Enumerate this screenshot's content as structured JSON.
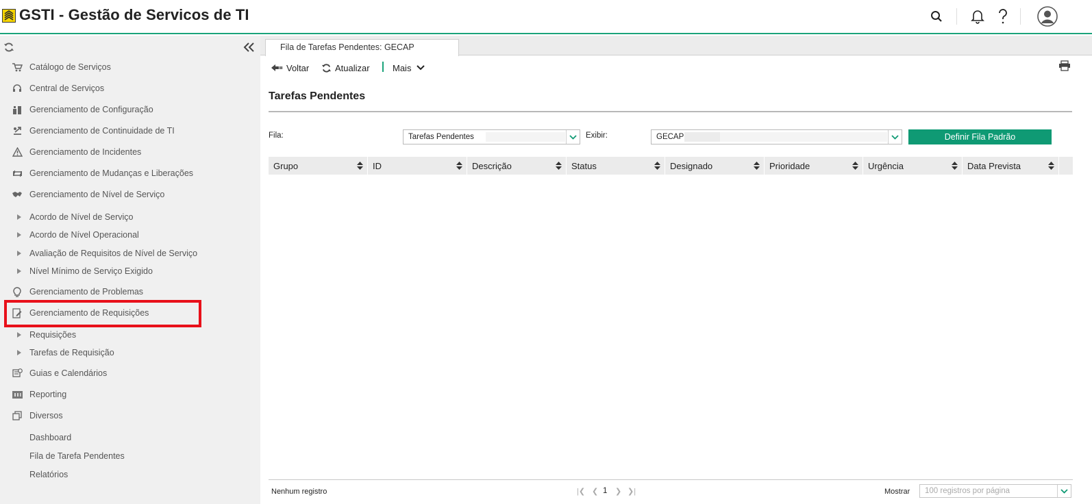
{
  "header": {
    "title": "GSTI - Gestão de Servicos de TI",
    "icons": [
      "search-icon",
      "bell-icon",
      "help-icon",
      "user-avatar-icon"
    ],
    "accent_color": "#1aa37a"
  },
  "sidebar": {
    "items": [
      {
        "label": "Catálogo de Serviços",
        "icon": "cart-icon",
        "type": "section"
      },
      {
        "label": "Central de Serviços",
        "icon": "headset-icon",
        "type": "section"
      },
      {
        "label": "Gerenciamento de Configuração",
        "icon": "configuration-icon",
        "type": "section"
      },
      {
        "label": "Gerenciamento de Continuidade de TI",
        "icon": "continuity-icon",
        "type": "section"
      },
      {
        "label": "Gerenciamento de Incidentes",
        "icon": "warning-icon",
        "type": "section"
      },
      {
        "label": "Gerenciamento de Mudanças e Liberações",
        "icon": "change-icon",
        "type": "section"
      },
      {
        "label": "Gerenciamento de Nível de Serviço",
        "icon": "handshake-icon",
        "type": "section"
      },
      {
        "label": "Acordo de Nível de Serviço",
        "type": "sub"
      },
      {
        "label": "Acordo de Nível Operacional",
        "type": "sub"
      },
      {
        "label": "Avaliação de Requisitos de Nível de Serviço",
        "type": "sub"
      },
      {
        "label": "Nível Mínimo de Serviço Exigido",
        "type": "sub"
      },
      {
        "label": "Gerenciamento de Problemas",
        "icon": "lightbulb-icon",
        "type": "section"
      },
      {
        "label": "Gerenciamento de Requisições",
        "icon": "request-edit-icon",
        "type": "section",
        "highlighted": true
      },
      {
        "label": "Requisições",
        "type": "sub"
      },
      {
        "label": "Tarefas de Requisição",
        "type": "sub"
      },
      {
        "label": "Guias e Calendários",
        "icon": "calendar-icon",
        "type": "section"
      },
      {
        "label": "Reporting",
        "icon": "reporting-icon",
        "type": "section"
      },
      {
        "label": "Diversos",
        "icon": "copy-icon",
        "type": "section"
      },
      {
        "label": "Dashboard",
        "type": "plain"
      },
      {
        "label": "Fila de Tarefa Pendentes",
        "type": "plain"
      },
      {
        "label": "Relatórios",
        "type": "plain"
      }
    ],
    "highlight_color": "#e8101a"
  },
  "main": {
    "tab_label": "Fila de Tarefas Pendentes: GECAP",
    "toolbar": {
      "back_label": "Voltar",
      "refresh_label": "Atualizar",
      "more_label": "Mais"
    },
    "page_title": "Tarefas Pendentes",
    "form": {
      "queue_label": "Fila:",
      "queue_value": "Tarefas Pendentes",
      "show_label": "Exibir:",
      "show_value": "GECAP",
      "default_button": "Definir Fila Padrão"
    },
    "table": {
      "columns": [
        "Grupo",
        "ID",
        "Descrição",
        "Status",
        "Designado",
        "Prioridade",
        "Urgência",
        "Data Prevista"
      ],
      "rows": []
    },
    "footer": {
      "records_text": "Nenhum registro",
      "page_number": "1",
      "show_label": "Mostrar",
      "per_page_value": "100 registros por página"
    },
    "button_color": "#0f9a74"
  }
}
